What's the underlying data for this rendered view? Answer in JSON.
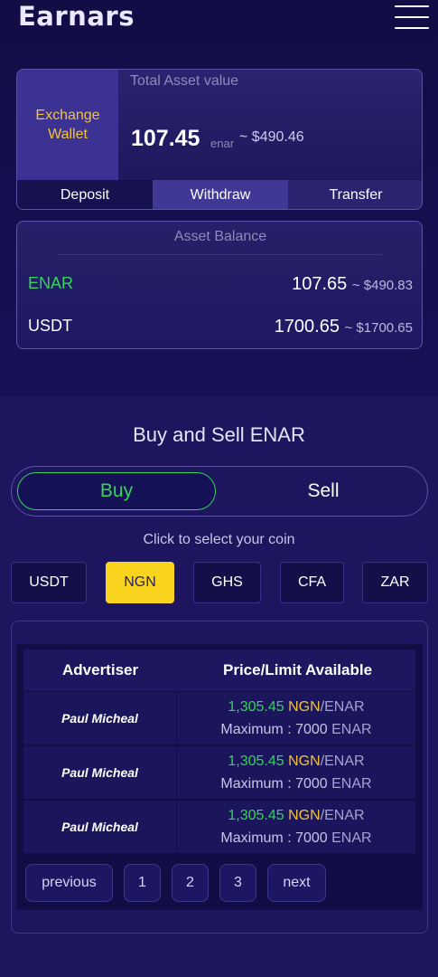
{
  "header": {
    "logo_text": "Earnars",
    "menu_icon": "hamburger-menu-icon"
  },
  "wallet": {
    "label_line1": "Exchange",
    "label_line2": "Wallet",
    "total_title": "Total Asset value",
    "total_value": "107.45",
    "total_unit": "enar",
    "total_usd": "~ $490.46",
    "actions": [
      "Deposit",
      "Withdraw",
      "Transfer"
    ],
    "active_action": "Withdraw"
  },
  "balance": {
    "title": "Asset Balance",
    "rows": [
      {
        "name": "ENAR",
        "amount": "107.65",
        "usd": "~ $490.83",
        "name_color": "#35d35a"
      },
      {
        "name": "USDT",
        "amount": "1700.65",
        "usd": "~ $1700.65",
        "name_color": "#ffffff"
      }
    ]
  },
  "trade": {
    "title": "Buy and Sell ENAR",
    "buy_label": "Buy",
    "sell_label": "Sell",
    "active_side": "Buy",
    "coin_hint": "Click to select your coin",
    "coins": [
      "USDT",
      "NGN",
      "GHS",
      "CFA",
      "ZAR"
    ],
    "selected_coin": "NGN"
  },
  "table": {
    "headers": {
      "advertiser": "Advertiser",
      "price": "Price/Limit Available"
    },
    "rows": [
      {
        "advertiser": "Paul Micheal",
        "price": "1,305.45",
        "currency": "NGN",
        "slash_unit": "/ENAR",
        "limit_label": "Maximum : 7000",
        "limit_unit": "ENAR"
      },
      {
        "advertiser": "Paul Micheal",
        "price": "1,305.45",
        "currency": "NGN",
        "slash_unit": "/ENAR",
        "limit_label": "Maximum : 7000",
        "limit_unit": "ENAR"
      },
      {
        "advertiser": "Paul Micheal",
        "price": "1,305.45",
        "currency": "NGN",
        "slash_unit": "/ENAR",
        "limit_label": "Maximum : 7000",
        "limit_unit": "ENAR"
      }
    ]
  },
  "pagination": {
    "previous": "previous",
    "pages": [
      "1",
      "2",
      "3"
    ],
    "next": "next"
  },
  "colors": {
    "accent_green": "#35d35a",
    "accent_yellow": "#f8d41f",
    "background": "#1a145a"
  }
}
